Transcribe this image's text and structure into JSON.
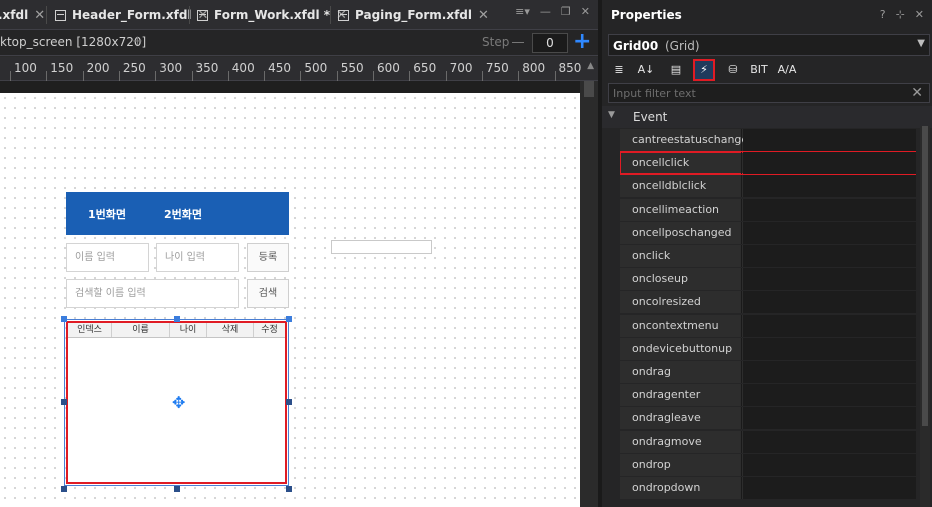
{
  "tabs": [
    {
      "label": ".xfdl",
      "close": "✕"
    },
    {
      "label": "Header_Form.xfdl",
      "close": "✕"
    },
    {
      "label": "Form_Work.xfdl *",
      "close": "✕"
    },
    {
      "label": "Paging_Form.xfdl",
      "close": "✕"
    }
  ],
  "tab_tools": {
    "menu": "≡▾",
    "minimize": "—",
    "restore": "❐",
    "close": "✕"
  },
  "screen": {
    "label": "ktop_screen [1280x720]",
    "add": "+"
  },
  "step": {
    "label": "Step",
    "value": "0",
    "add_icon": "+"
  },
  "ruler": {
    "marks": [
      "100",
      "150",
      "200",
      "250",
      "300",
      "350",
      "400",
      "450",
      "500",
      "550",
      "600",
      "650",
      "700",
      "750",
      "800",
      "850"
    ],
    "scroll_up": "▲"
  },
  "form": {
    "tab1": "1번화면",
    "tab2": "2번화면",
    "name_placeholder": "이름 입력",
    "age_placeholder": "나이 입력",
    "register_button": "등록",
    "search_placeholder": "검색할 이름 입력",
    "search_button": "검색",
    "grid_columns": [
      "인덱스",
      "이름",
      "나이",
      "삭제",
      "수정"
    ],
    "move_icon": "✥"
  },
  "properties": {
    "title": "Properties",
    "tools": {
      "help": "?",
      "pin": "⊹",
      "close": "✕"
    },
    "object_name": "Grid00",
    "object_type": "(Grid)",
    "object_caret": "▼",
    "toolbar": [
      {
        "icon": "categorized-view-icon",
        "glyph": "≣"
      },
      {
        "icon": "sort-alphabetical-icon",
        "glyph": "A↓"
      },
      {
        "icon": "property-page-icon",
        "glyph": "▤"
      },
      {
        "icon": "event-list-icon",
        "glyph": "⚡"
      },
      {
        "icon": "binding-icon",
        "glyph": "⛁"
      },
      {
        "icon": "bind-item-icon",
        "glyph": "BIT"
      },
      {
        "icon": "text-resource-icon",
        "glyph": "A/A"
      }
    ],
    "active_tool_index": 3,
    "filter_placeholder": "Input filter text",
    "filter_clear": "✕",
    "category": "Event",
    "category_caret": "▼",
    "events": [
      "cantreestatuschange",
      "oncellclick",
      "oncelldblclick",
      "oncellimeaction",
      "oncellposchanged",
      "onclick",
      "oncloseup",
      "oncolresized",
      "oncontextmenu",
      "ondevicebuttonup",
      "ondrag",
      "ondragenter",
      "ondragleave",
      "ondragmove",
      "ondrop",
      "ondropdown"
    ],
    "highlighted_event": "oncellclick"
  }
}
